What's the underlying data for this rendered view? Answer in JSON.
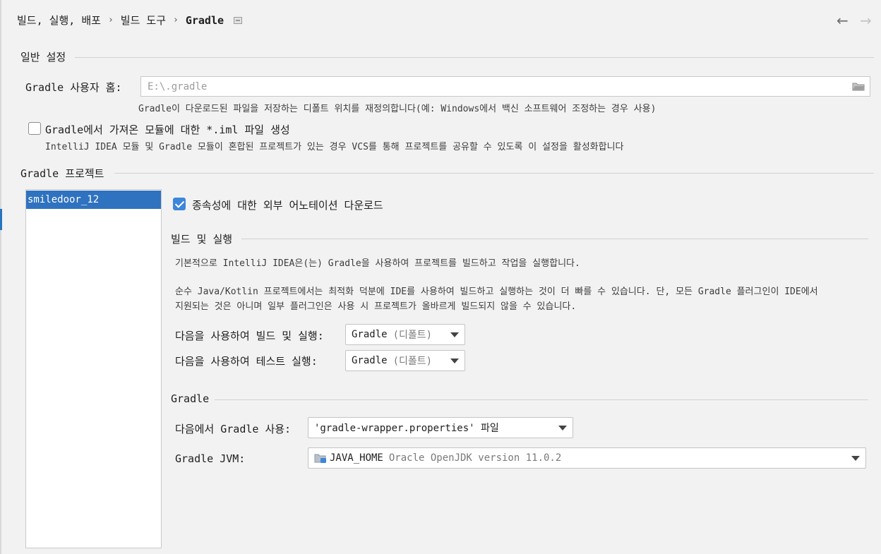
{
  "breadcrumb": {
    "items": [
      "빌드, 실행, 배포",
      "빌드 도구"
    ],
    "current": "Gradle",
    "separator": "›"
  },
  "nav": {
    "back": "←",
    "forward": "→"
  },
  "general": {
    "title": "일반 설정",
    "user_home_label": "Gradle 사용자 홈:",
    "user_home_placeholder": "E:\\.gradle",
    "user_home_hint": "Gradle이 다운로드된 파일을 저장하는 디폴트 위치를 재정의합니다(예: Windows에서 백신 소프트웨어 조정하는 경우 사용)",
    "iml_checkbox_label": "Gradle에서 가져온 모듈에 대한 *.iml 파일 생성",
    "iml_checkbox_checked": false,
    "iml_hint": "IntelliJ IDEA 모듈 및 Gradle 모듈이 혼합된 프로젝트가 있는 경우 VCS를 통해 프로젝트를 공유할 수 있도록 이 설정을 활성화합니다"
  },
  "projects": {
    "title": "Gradle 프로젝트",
    "items": [
      "smiledoor_12"
    ],
    "selected": "smiledoor_12"
  },
  "project_settings": {
    "download_annotations_label": "종속성에 대한 외부 어노테이션 다운로드",
    "download_annotations_checked": true,
    "build_run": {
      "title": "빌드 및 실행",
      "desc1": "기본적으로 IntelliJ IDEA은(는) Gradle을 사용하여 프로젝트를 빌드하고 작업을 실행합니다.",
      "desc2_line1": "순수 Java/Kotlin 프로젝트에서는 최적화 덕분에 IDE를 사용하여 빌드하고 실행하는 것이 더 빠를 수 있습니다. 단, 모든 Gradle 플러그인이 IDE에서",
      "desc2_line2": "지원되는 것은 아니며 일부 플러그인은 사용 시 프로젝트가 올바르게 빌드되지 않을 수 있습니다.",
      "build_using_label": "다음을 사용하여 빌드 및 실행:",
      "build_using_value": "Gradle",
      "build_using_suffix": "(디폴트)",
      "test_using_label": "다음을 사용하여 테스트 실행:",
      "test_using_value": "Gradle",
      "test_using_suffix": "(디폴트)"
    },
    "gradle": {
      "title": "Gradle",
      "use_from_label": "다음에서 Gradle 사용:",
      "use_from_value": "'gradle-wrapper.properties' 파일",
      "jvm_label": "Gradle JVM:",
      "jvm_name": "JAVA_HOME",
      "jvm_detail": "Oracle OpenJDK version 11.0.2"
    }
  },
  "colors": {
    "accent": "#2f72c0",
    "checkbox_checked": "#3d86d9",
    "background": "#f2f2f2"
  },
  "icons": [
    "file-icon",
    "back-arrow-icon",
    "forward-arrow-icon",
    "folder-icon",
    "check-icon",
    "dropdown-arrow-icon",
    "jdk-folder-icon"
  ]
}
